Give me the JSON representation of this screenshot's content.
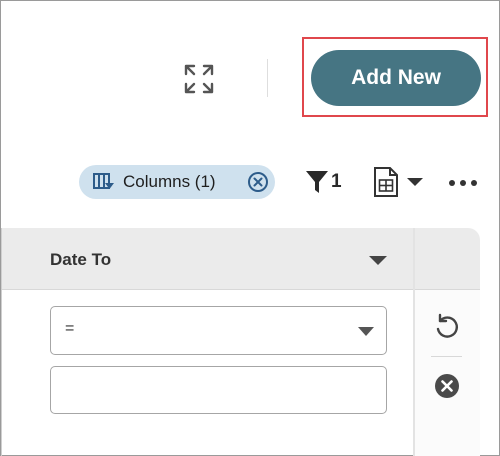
{
  "header": {
    "add_new_label": "Add New",
    "expand_icon": "expand-icon"
  },
  "toolbar": {
    "columns_chip_label": "Columns (1)",
    "filter_count": "1",
    "columns_icon": "columns-filter-icon",
    "export_icon": "spreadsheet-export-icon",
    "more_icon": "more-dots-icon"
  },
  "grid": {
    "column_header": "Date To",
    "operator_value": "=",
    "filter_value": ""
  },
  "colors": {
    "accent": "#467583",
    "chip_bg": "#cfe1ee",
    "highlight": "#e0474c"
  }
}
